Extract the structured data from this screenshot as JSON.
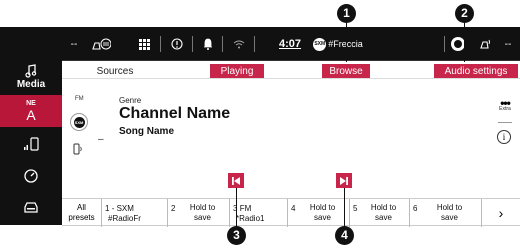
{
  "topbar": {
    "left_text": "--",
    "time": "4:07",
    "station_badge": "SXM",
    "station": "#Freccia",
    "right_text": "--"
  },
  "sidebar": {
    "media_label": "Media",
    "ne_label": "NE",
    "a_label": "A"
  },
  "tabs": {
    "sources": "Sources",
    "playing": "Playing",
    "browse": "Browse",
    "audio_settings": "Audio settings"
  },
  "main": {
    "band": "FM",
    "logo_text": "SXM",
    "dash": "–",
    "genre": "Genre",
    "channel": "Channel Name",
    "song": "Song Name",
    "extra_dots": "•••",
    "extra_label": "Extra",
    "info": "i"
  },
  "presets": {
    "all_line1": "All",
    "all_line2": "presets",
    "items": [
      {
        "num": "1",
        "name": "- SXM",
        "sub": "#RadioFr"
      },
      {
        "num": "2",
        "text1": "Hold to",
        "text2": "save"
      },
      {
        "num": "3",
        "name": "FM",
        "sub": "*Radio1"
      },
      {
        "num": "4",
        "text1": "Hold to",
        "text2": "save"
      },
      {
        "num": "5",
        "text1": "Hold to",
        "text2": "save"
      },
      {
        "num": "6",
        "text1": "Hold to",
        "text2": "save"
      }
    ],
    "next": "›"
  },
  "callouts": [
    "1",
    "2",
    "3",
    "4"
  ],
  "colors": {
    "accent": "#c8254a",
    "bar": "#111111"
  }
}
